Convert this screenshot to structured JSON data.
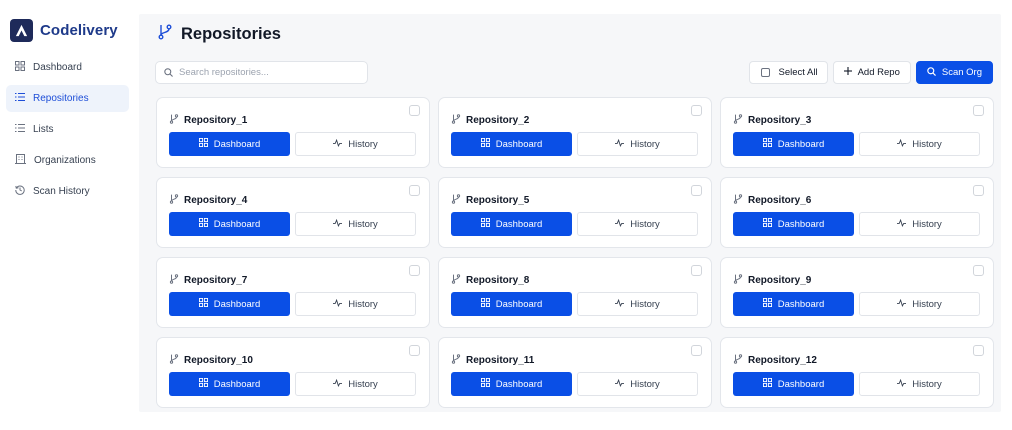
{
  "app": {
    "name": "Codelivery",
    "logo_icon": "codelivery-logo-icon"
  },
  "colors": {
    "primary": "#0a4fe6",
    "brand_text": "#1e3a8a",
    "active_nav_bg": "#eef3fb",
    "main_bg": "#f6f7f9"
  },
  "sidebar": {
    "items": [
      {
        "label": "Dashboard",
        "icon": "grid-icon",
        "active": false
      },
      {
        "label": "Repositories",
        "icon": "list-icon",
        "active": true
      },
      {
        "label": "Lists",
        "icon": "list-icon",
        "active": false
      },
      {
        "label": "Organizations",
        "icon": "building-icon",
        "active": false
      },
      {
        "label": "Scan History",
        "icon": "history-icon",
        "active": false
      }
    ]
  },
  "page": {
    "title": "Repositories",
    "title_icon": "git-branch-icon"
  },
  "search": {
    "placeholder": "Search repositories...",
    "value": ""
  },
  "toolbar": {
    "select_all_label": "Select All",
    "add_repo_label": "Add Repo",
    "scan_org_label": "Scan Org"
  },
  "card_actions": {
    "dashboard_label": "Dashboard",
    "history_label": "History"
  },
  "repositories": [
    {
      "name": "Repository_1"
    },
    {
      "name": "Repository_2"
    },
    {
      "name": "Repository_3"
    },
    {
      "name": "Repository_4"
    },
    {
      "name": "Repository_5"
    },
    {
      "name": "Repository_6"
    },
    {
      "name": "Repository_7"
    },
    {
      "name": "Repository_8"
    },
    {
      "name": "Repository_9"
    },
    {
      "name": "Repository_10"
    },
    {
      "name": "Repository_11"
    },
    {
      "name": "Repository_12"
    }
  ]
}
